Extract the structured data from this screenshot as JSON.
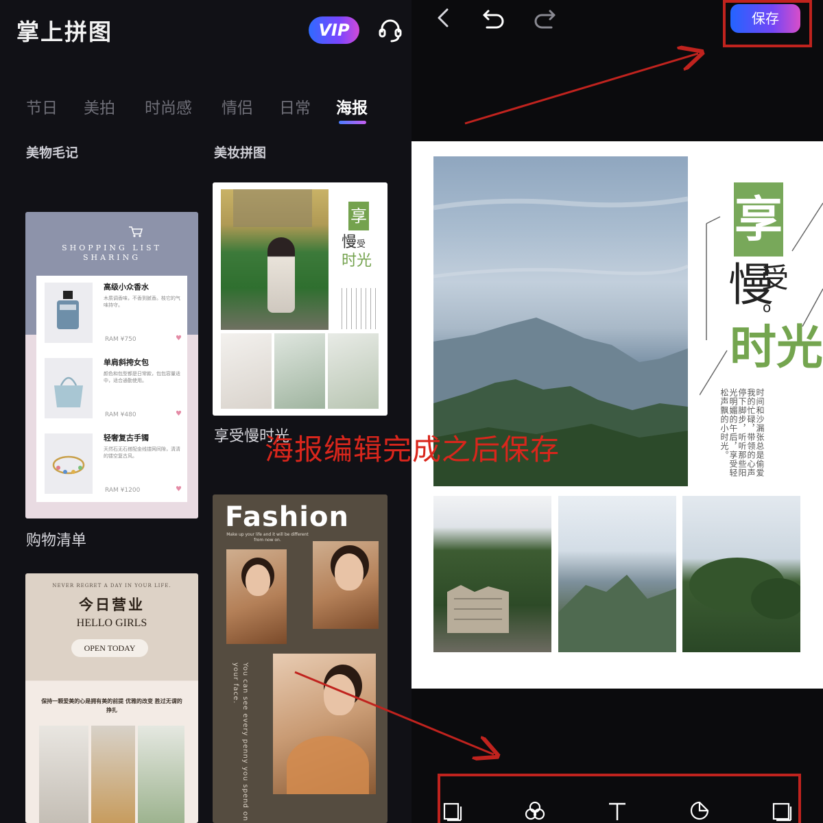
{
  "app": {
    "title": "掌上拼图",
    "vip_label": "VIP",
    "support_icon": "headset-icon"
  },
  "tabs": [
    {
      "label": "节日",
      "active": false
    },
    {
      "label": "美拍",
      "active": false
    },
    {
      "label": "时尚感",
      "active": false
    },
    {
      "label": "情侣",
      "active": false
    },
    {
      "label": "日常",
      "active": false
    },
    {
      "label": "海报",
      "active": true
    }
  ],
  "categories": {
    "left": "美物毛记",
    "right": "美妆拼图"
  },
  "templates": {
    "shopping": {
      "caption": "购物清单",
      "heading_line1": "SHOPPING LIST",
      "heading_line2": "SHARING",
      "items": [
        {
          "name": "高级小众香水",
          "desc": "木质调香味，不香到腻香。枝它的气味持守。",
          "price": "RAM ¥750"
        },
        {
          "name": "单肩斜挎女包",
          "desc": "颜色和包型都是日常款，包包容量适中，适合通勤使用。",
          "price": "RAM ¥480"
        },
        {
          "name": "轻奢复古手镯",
          "desc": "天然石无石搭配金线镂网间隙，清清的镂空复古风。",
          "price": "RAM ¥1200"
        }
      ]
    },
    "beauty": {
      "caption": "享受慢时光",
      "box_char": "享",
      "sub_line1": "慢",
      "sub_line1b": "受",
      "sub_line2": "时光"
    },
    "today": {
      "top_line": "NEVER REGRET A DAY IN YOUR LIFE.",
      "title_cn": "今日营业",
      "title_en": "HELLO GIRLS",
      "button": "OPEN TODAY",
      "slogan": "保持一颗爱美的心是拥有美的前提 优雅的改变 胜过无谓的挣扎"
    },
    "fashion": {
      "title": "Fashion",
      "tagline": "Make up your life and it will be different from now on.",
      "vertical_text": "You can see every penny you spend on your face."
    }
  },
  "editor": {
    "back_icon": "back-arrow-icon",
    "undo_icon": "undo-icon",
    "redo_icon": "redo-icon",
    "save_label": "保存",
    "poster": {
      "headline_box": "享",
      "headline_sub1": "慢",
      "headline_sub1b": "受",
      "headline_sub1c": "o",
      "headline_sub2": "时光",
      "body_text": "时间和沙漏张总是偷爱我的忙碌，带领的心声停下脚步，听听那些阳光明媚的午后，享受轻松声飘的小时光。"
    },
    "toolbar": [
      {
        "icon": "layout-icon"
      },
      {
        "icon": "filter-icon"
      },
      {
        "icon": "text-icon"
      },
      {
        "icon": "sticker-icon"
      },
      {
        "icon": "frame-icon"
      }
    ]
  },
  "annotation": {
    "caption": "海报编辑完成之后保存",
    "color": "#d9261c"
  },
  "colors": {
    "accent_gradient_start": "#2364ff",
    "accent_gradient_end": "#d84ec9",
    "highlight_red": "#c0231e",
    "poster_green": "#78a85a"
  }
}
